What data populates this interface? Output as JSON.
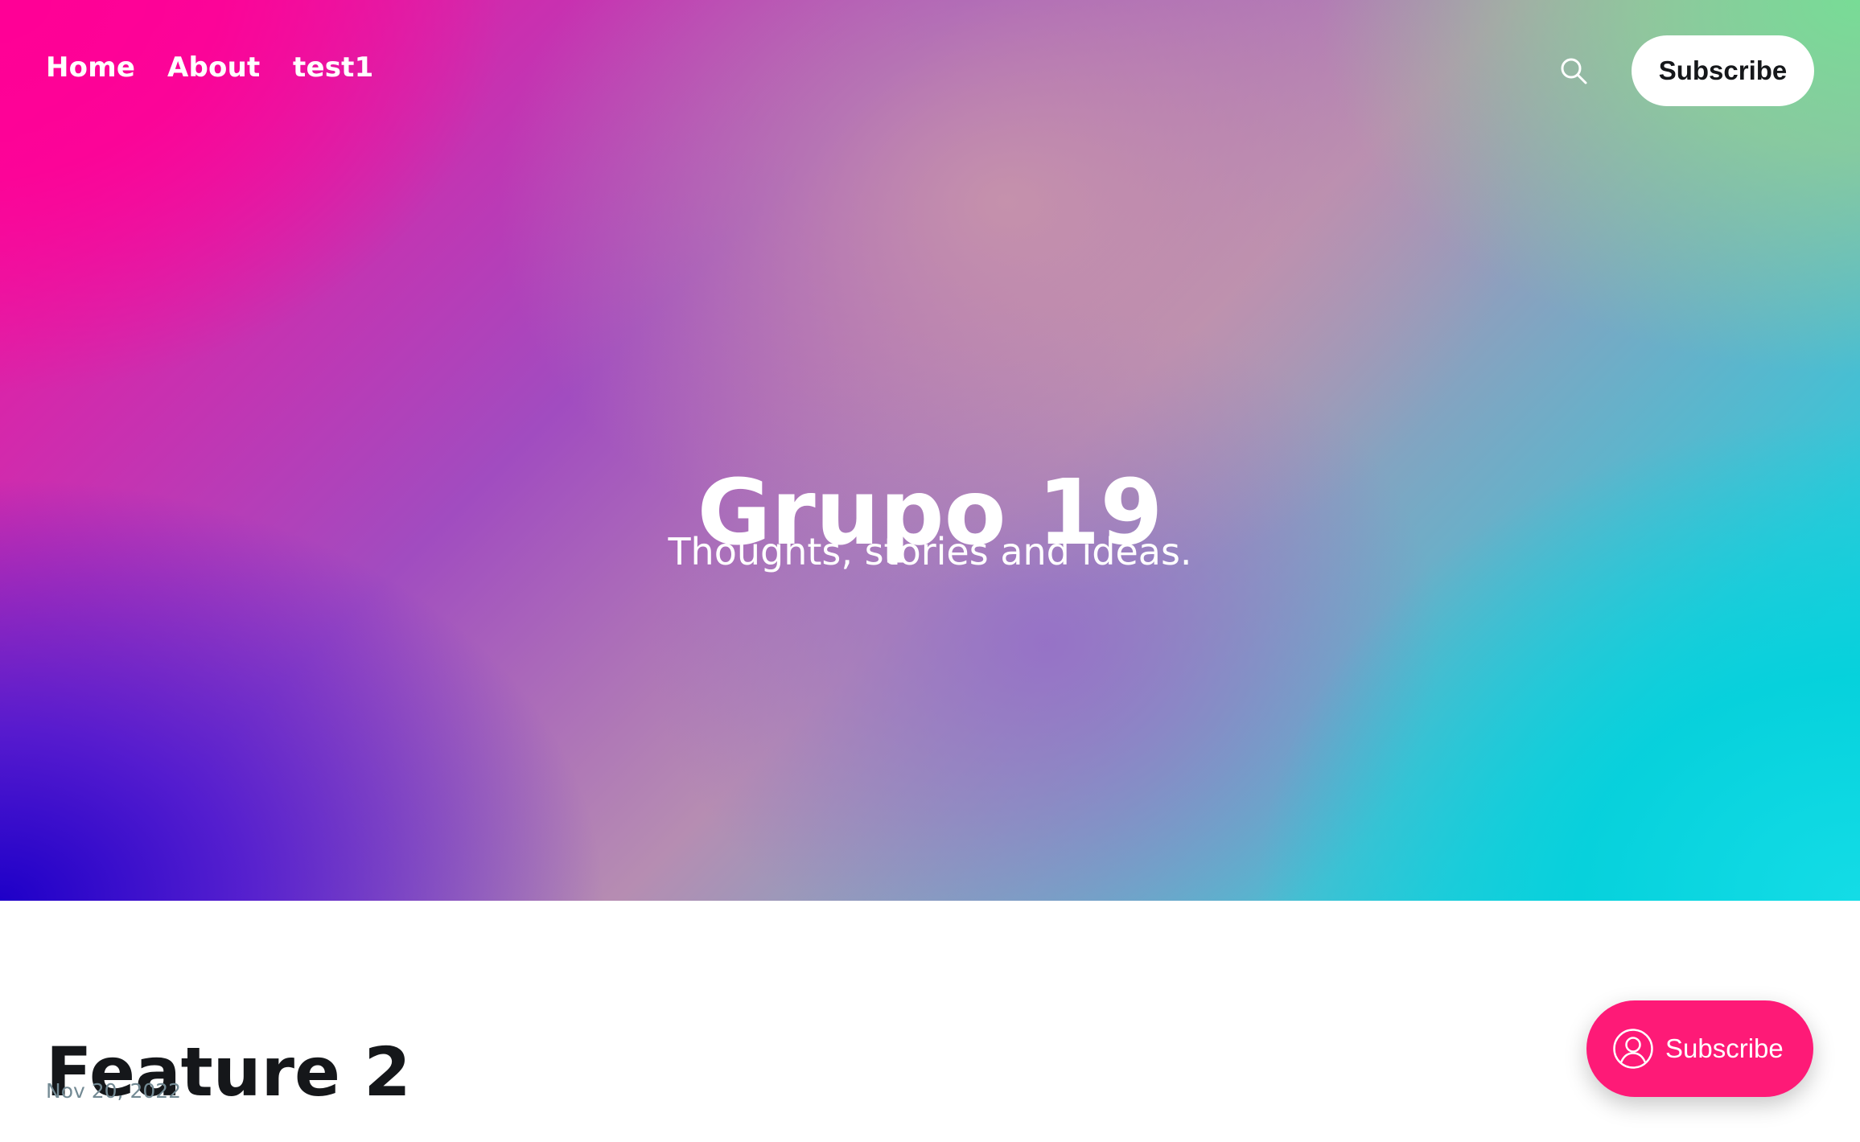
{
  "nav": {
    "items": [
      {
        "label": "Home"
      },
      {
        "label": "About"
      },
      {
        "label": "test1"
      }
    ],
    "search_icon": "search-icon",
    "subscribe_label": "Subscribe"
  },
  "hero": {
    "title": "Grupo 19",
    "subtitle": "Thoughts, stories and ideas."
  },
  "post": {
    "title": "Feature 2",
    "date": "Nov 20, 2022"
  },
  "portal": {
    "icon": "user-circle-icon",
    "label": "Subscribe"
  },
  "colors": {
    "portal_button": "#fe1a77",
    "text_dark": "#15171a",
    "date_gray": "#738a94"
  }
}
